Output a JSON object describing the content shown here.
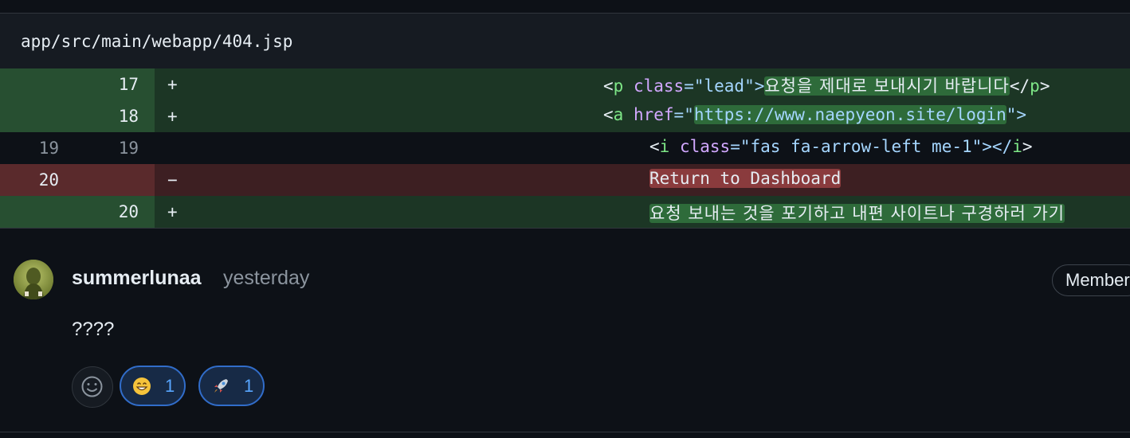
{
  "file": {
    "path": "app/src/main/webapp/404.jsp"
  },
  "diff": {
    "rows": [
      {
        "type": "add",
        "old": "",
        "new": "17",
        "marker": "+",
        "tokens": [
          "<",
          "p",
          " ",
          "class",
          "=\"",
          "lead",
          "\">",
          "요청을 제대로 보내시기 바랍니다",
          "</",
          "p",
          ">"
        ]
      },
      {
        "type": "add",
        "old": "",
        "new": "18",
        "marker": "+",
        "tokens": [
          "<",
          "a",
          " ",
          "href",
          "=\"",
          "https://www.naepyeon.site/login",
          "\">"
        ]
      },
      {
        "type": "ctx",
        "old": "19",
        "new": "19",
        "marker": "",
        "tokens": [
          "<",
          "i",
          " ",
          "class",
          "=\"",
          "fas fa-arrow-left me-1",
          "\"></",
          "i",
          ">"
        ]
      },
      {
        "type": "del",
        "old": "20",
        "new": "",
        "marker": "−",
        "tokens": [
          "Return to Dashboard"
        ]
      },
      {
        "type": "add",
        "old": "",
        "new": "20",
        "marker": "+",
        "tokens": [
          "요청 보내는 것을 포기하고 내편 사이트나 구경하러 가기"
        ]
      }
    ]
  },
  "comment": {
    "author": "summerlunaa",
    "time": "yesterday",
    "badge": "Member",
    "body": "????",
    "reactions": [
      {
        "emoji": "😄",
        "count": "1"
      },
      {
        "emoji": "🚀",
        "count": "1"
      }
    ]
  },
  "icons": {
    "avatar": "avatar-icon",
    "picker": "smiley-icon"
  },
  "colors": {
    "add_bg": "#1c3625",
    "del_bg": "#3d1f22",
    "accent": "#58a6ff"
  }
}
